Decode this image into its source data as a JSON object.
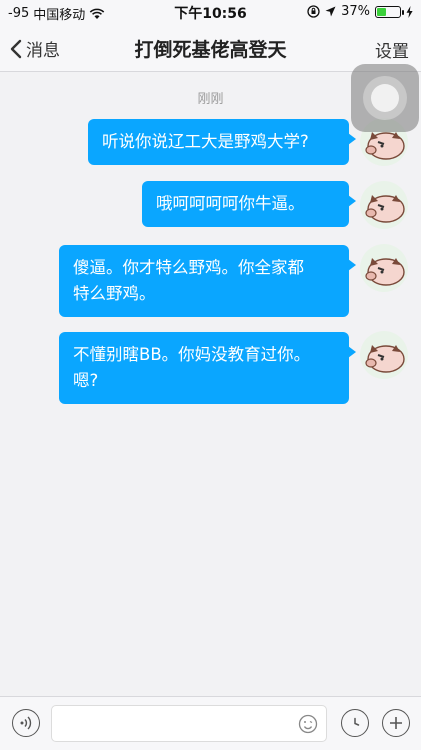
{
  "status_bar": {
    "signal": "-95",
    "carrier": "中国移动",
    "time": "下午10:56",
    "battery_percent": "37%",
    "battery_level": 0.37
  },
  "nav": {
    "back_label": "消息",
    "title": "打倒死基佬高登天",
    "settings_label": "设置"
  },
  "chat": {
    "timestamp": "刚刚",
    "messages": [
      {
        "line1": "听说你说辽工大是野鸡大学?",
        "line2": ""
      },
      {
        "line1": "哦呵呵呵呵你牛逼。",
        "line2": ""
      },
      {
        "line1": "傻逼。你才特么野鸡。你全家都",
        "line2": "特么野鸡。"
      },
      {
        "line1": "不懂别瞎BB。你妈没教育过你。",
        "line2": "嗯?"
      }
    ]
  },
  "input_bar": {
    "voice_icon": "voice-icon",
    "emoji_icon": "emoji-icon",
    "clock_icon": "clock-icon",
    "plus_icon": "plus-icon"
  },
  "colors": {
    "bubble": "#0aa6ff",
    "background": "#f2f2f4"
  }
}
